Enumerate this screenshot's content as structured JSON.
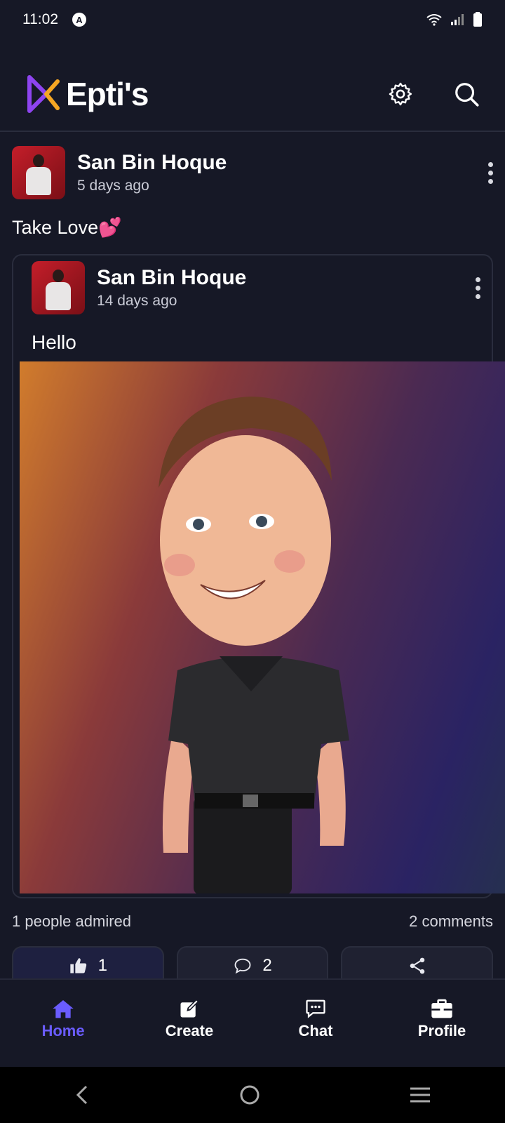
{
  "status_bar": {
    "time": "11:02",
    "notification_icon": "A"
  },
  "app": {
    "name": "Epti's",
    "accent": "#6a5cff"
  },
  "post": {
    "author": "San Bin Hoque",
    "time": "5 days ago",
    "text": "Take Love💕",
    "shared": {
      "author": "San Bin Hoque",
      "time": "14 days ago",
      "text": "Hello"
    },
    "admired_text": "1 people admired",
    "comments_text": "2 comments",
    "like_count": "1",
    "comment_count": "2"
  },
  "nav": {
    "items": [
      {
        "label": "Home",
        "icon": "home-icon"
      },
      {
        "label": "Create",
        "icon": "edit-icon"
      },
      {
        "label": "Chat",
        "icon": "chat-icon"
      },
      {
        "label": "Profile",
        "icon": "briefcase-icon"
      }
    ]
  }
}
